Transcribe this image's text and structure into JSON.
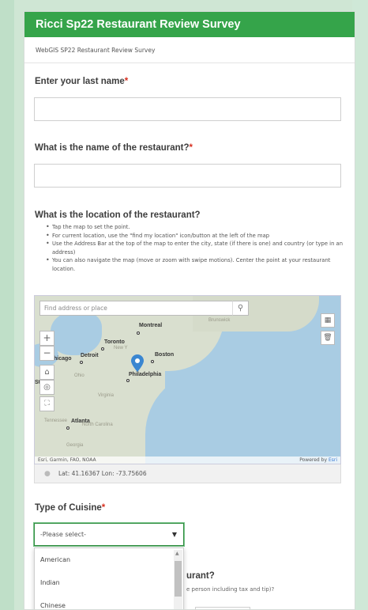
{
  "form": {
    "title": "Ricci Sp22 Restaurant Review Survey",
    "subtitle": "WebGIS SP22 Restaurant Review Survey",
    "required_mark": "*"
  },
  "questions": {
    "last_name": {
      "label": "Enter your last name"
    },
    "restaurant_name": {
      "label": "What is the name of the restaurant?"
    },
    "location": {
      "label": "What is the location of the restaurant?",
      "help": [
        "Tap the map to set the point.",
        "For current location, use the \"find my location\" icon/button at the left of the map",
        "Use the Address Bar at the top of the map to enter the city, state (if there is one) and country (or type in an address)",
        "You can also navigate the map (move or zoom with swipe motions). Center the point at your restaurant location."
      ]
    },
    "cuisine": {
      "label": "Type of Cuisine",
      "selected": "-Please select-",
      "options": [
        "American",
        "Indian",
        "Chinese"
      ]
    },
    "next": {
      "label_partial": "urant?",
      "help_partial": "e person including tax and tip)?"
    }
  },
  "map": {
    "search_placeholder": "Find address or place",
    "attribution": "Esri, Garmin, FAO, NOAA",
    "powered_by": "Powered by",
    "powered_by_brand": "Esri",
    "lat_lon": "Lat: 41.16367  Lon: -73.75606",
    "cities": [
      "Montreal",
      "Toronto",
      "Detroit",
      "Boston",
      "Philadelphia",
      "Atlanta",
      "hicago"
    ],
    "regions": [
      "Ohio",
      "Virginia",
      "Tennessee",
      "North Carolina",
      "Georgia",
      "New Y",
      "Brunswick",
      "St"
    ],
    "pin_color": "#3a86d1"
  },
  "colors": {
    "header": "#35a44a",
    "required": "#d83020",
    "select_focus": "#2f8d3f"
  }
}
